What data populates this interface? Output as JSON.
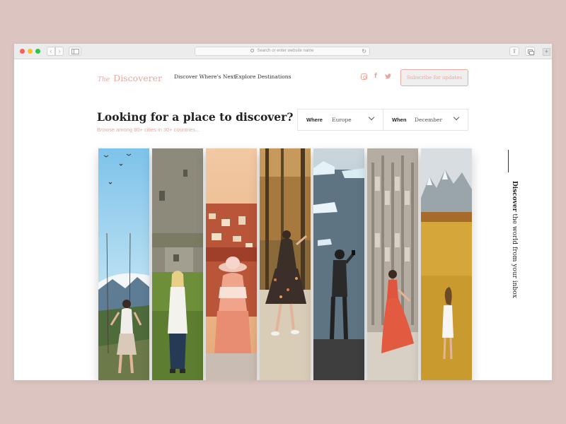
{
  "browser": {
    "url_placeholder": "Search or enter website name"
  },
  "header": {
    "logo_prefix": "The",
    "logo_name": "Discoverer",
    "nav": [
      "Discover Where's Next",
      "Explore Destinations"
    ],
    "social": [
      "instagram-icon",
      "facebook-icon",
      "twitter-icon"
    ],
    "subscribe_label": "Subscribe for updates"
  },
  "hero": {
    "title": "Looking for a place to discover?",
    "subtitle": "Browse among 80+ cities in 30+ countries..."
  },
  "filters": {
    "where_label": "Where",
    "where_value": "Europe",
    "when_label": "When",
    "when_value": "December"
  },
  "destinations": [
    {
      "scene": "woman-on-swing-mountains"
    },
    {
      "scene": "woman-by-stone-castle"
    },
    {
      "scene": "woman-in-hat-over-city"
    },
    {
      "scene": "woman-in-autumn-forest"
    },
    {
      "scene": "person-at-glacier-lagoon"
    },
    {
      "scene": "woman-in-red-dress-cathedral"
    },
    {
      "scene": "woman-in-golden-meadow"
    }
  ],
  "side": {
    "bold": "Discover",
    "rest": "the world from your inbox"
  },
  "colors": {
    "accent": "#e9a8a0",
    "background": "#dcc5c1"
  }
}
